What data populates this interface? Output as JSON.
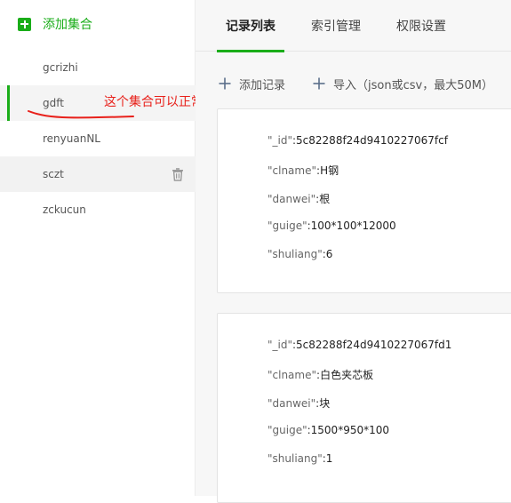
{
  "sidebar": {
    "add_label": "添加集合",
    "items": [
      {
        "label": "gcrizhi"
      },
      {
        "label": "gdft"
      },
      {
        "label": "renyuanNL"
      },
      {
        "label": "sczt"
      },
      {
        "label": "zckucun"
      }
    ]
  },
  "annotation": {
    "text": "这个集合可以正常输出",
    "color": "#e8201a"
  },
  "tabs": [
    {
      "label": "记录列表",
      "active": true
    },
    {
      "label": "索引管理",
      "active": false
    },
    {
      "label": "权限设置",
      "active": false
    }
  ],
  "toolbar": {
    "add_label": "添加记录",
    "import_label": "导入（json或csv，最大50M）"
  },
  "records": [
    {
      "fields": [
        {
          "key": "\"_id\"",
          "value": "5c82288f24d9410227067fcf"
        },
        {
          "key": "\"clname\"",
          "value": "H钢"
        },
        {
          "key": "\"danwei\"",
          "value": "根"
        },
        {
          "key": "\"guige\"",
          "value": "100*100*12000"
        },
        {
          "key": "\"shuliang\"",
          "value": "6"
        }
      ]
    },
    {
      "fields": [
        {
          "key": "\"_id\"",
          "value": "5c82288f24d9410227067fd1"
        },
        {
          "key": "\"clname\"",
          "value": "白色夹芯板"
        },
        {
          "key": "\"danwei\"",
          "value": "块"
        },
        {
          "key": "\"guige\"",
          "value": "1500*950*100"
        },
        {
          "key": "\"shuliang\"",
          "value": "1"
        }
      ]
    }
  ],
  "colors": {
    "accent": "#1aad19",
    "annotation": "#e8201a"
  },
  "icons": {
    "add_collection": "plus-square-icon",
    "delete": "trash-icon",
    "add_record": "plus-icon",
    "import": "plus-icon"
  }
}
